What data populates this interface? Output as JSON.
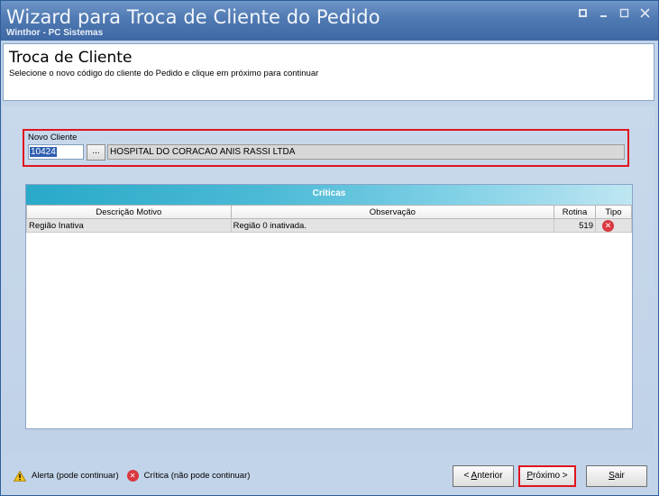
{
  "window": {
    "title": "Wizard para Troca de Cliente do Pedido",
    "subtitle": "Winthor - PC Sistemas"
  },
  "header": {
    "heading": "Troca de Cliente",
    "instruction": "Selecione o novo código do cliente do Pedido e clique em próximo para continuar"
  },
  "cliente": {
    "label": "Novo Cliente",
    "code": "10424",
    "lookup_label": "...",
    "name": "HOSPITAL DO CORACAO ANIS RASSI LTDA"
  },
  "criticas": {
    "caption": "Críticas",
    "columns": [
      "Descrição Motivo",
      "Observação",
      "Rotina",
      "Tipo"
    ],
    "rows": [
      {
        "motivo": "Região Inativa",
        "observacao": "Região 0 inativada.",
        "rotina": "519",
        "tipo": "critica"
      }
    ]
  },
  "legend": {
    "alerta": "Alerta (pode continuar)",
    "critica": "Crítica (não pode continuar)"
  },
  "buttons": {
    "anterior_prefix": "< ",
    "anterior_key": "A",
    "anterior_rest": "nterior",
    "proximo_key": "P",
    "proximo_rest": "róximo >",
    "sair_key": "S",
    "sair_rest": "air"
  },
  "colors": {
    "title_bar": "#4f79b2",
    "highlight": "#e0141e",
    "grid_band": "#29a9c9",
    "error_icon": "#d9383f"
  }
}
